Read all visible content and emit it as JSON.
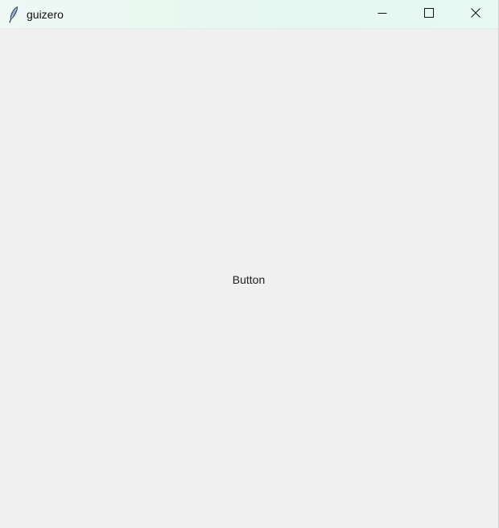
{
  "window": {
    "title": "guizero",
    "icon": "feather-icon",
    "controls": [
      "minimize-icon",
      "maximize-icon",
      "close-icon"
    ]
  },
  "content": {
    "button_label": "Button"
  },
  "colors": {
    "titlebar": "#e6f7f1",
    "background": "#f0f0f0",
    "text": "#202020"
  }
}
